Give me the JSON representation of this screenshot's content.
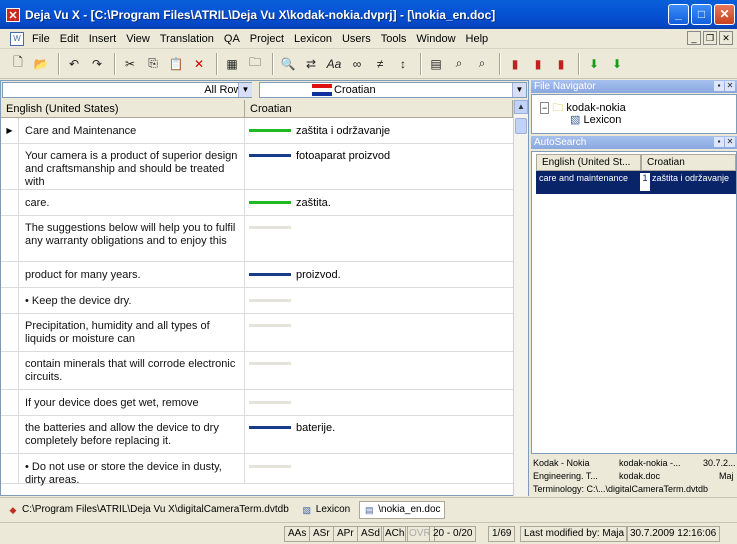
{
  "window": {
    "title": "Deja Vu X - [C:\\Program Files\\ATRIL\\Deja Vu X\\kodak-nokia.dvprj] - [\\nokia_en.doc]"
  },
  "menu": [
    "File",
    "Edit",
    "Insert",
    "View",
    "Translation",
    "QA",
    "Project",
    "Lexicon",
    "Users",
    "Tools",
    "Window",
    "Help"
  ],
  "filter": {
    "rows": "All Rows",
    "language": "Croatian"
  },
  "grid": {
    "columns": [
      "English (United States)",
      "Croatian"
    ],
    "rows": [
      {
        "source": "Care and Maintenance",
        "target": "zaštita i održavanje",
        "bar": "green",
        "current": true
      },
      {
        "source": "Your camera is a product of superior design and craftsmanship and should be treated with",
        "target": "fotoaparat proizvod",
        "bar": "blue"
      },
      {
        "source": "care.",
        "target": "zaštita.",
        "bar": "green"
      },
      {
        "source": "The suggestions below will help you to fulfil any warranty obligations and to enjoy this",
        "target": "",
        "bar": "empty"
      },
      {
        "source": "product for many years.",
        "target": "proizvod.",
        "bar": "blue"
      },
      {
        "source": "• Keep the device dry.",
        "target": "",
        "bar": "empty"
      },
      {
        "source": "Precipitation, humidity and all types of liquids or moisture can",
        "target": "",
        "bar": "empty"
      },
      {
        "source": "contain minerals that will corrode electronic circuits.",
        "target": "",
        "bar": "empty"
      },
      {
        "source": "If your device does get wet, remove",
        "target": "",
        "bar": "empty"
      },
      {
        "source": "the batteries and allow the device to dry completely before replacing it.",
        "target": "baterije.",
        "bar": "blue"
      },
      {
        "source": "• Do not use or store the device in dusty, dirty areas.",
        "target": "",
        "bar": "empty"
      }
    ]
  },
  "navigator": {
    "title": "File Navigator",
    "project": "kodak-nokia",
    "child": "Lexicon"
  },
  "autosearch": {
    "title": "AutoSearch",
    "columns": [
      "English (United St...",
      "Croatian"
    ],
    "result": {
      "source": "care and maintenance",
      "index": "1",
      "target": "zaštita i održavanje"
    }
  },
  "details": {
    "line1": [
      "Kodak - Nokia",
      "kodak-nokia -...",
      "30.7.2..."
    ],
    "line2": [
      "Engineering. T...",
      "kodak.doc",
      "Maj"
    ],
    "line3": "Terminology: C:\\...\\digitalCameraTerm.dvtdb"
  },
  "tabs": [
    {
      "label": "C:\\Program Files\\ATRIL\\Deja Vu X\\digitalCameraTerm.dvtdb"
    },
    {
      "label": "Lexicon"
    },
    {
      "label": "\\nokia_en.doc"
    }
  ],
  "status": {
    "aas": "AAs",
    "asr": "ASr",
    "apr": "APr",
    "asd": "ASd",
    "ach": "ACh",
    "ovr": "OVR",
    "range": "20 - 0/20",
    "page": "1/69",
    "modified": "Last modified by: Maja",
    "date": "30.7.2009 12:16:06"
  },
  "colors": {
    "green": "#22b822",
    "blue": "#1a3a8a",
    "empty": "#e4e4dc"
  }
}
